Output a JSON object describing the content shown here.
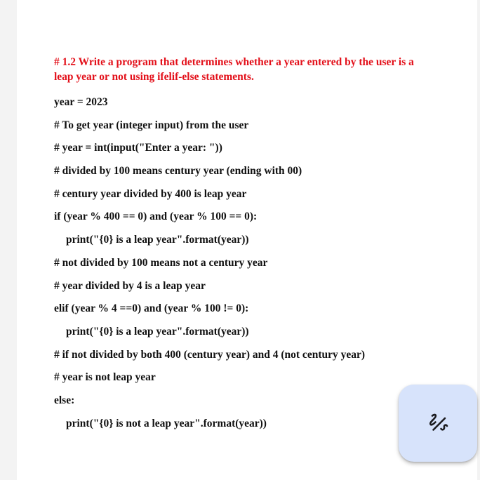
{
  "document": {
    "heading": "# 1.2 Write a program that determines whether a year entered by the user is a leap year or not using ifelif-else statements.",
    "lines": [
      {
        "text": "year = 2023",
        "indent": false
      },
      {
        "text": "# To get year (integer input) from the user",
        "indent": false
      },
      {
        "text": "# year = int(input(\"Enter a year: \"))",
        "indent": false
      },
      {
        "text": "# divided by 100 means century year (ending with 00)",
        "indent": false
      },
      {
        "text": "# century year divided by 400 is leap year",
        "indent": false
      },
      {
        "text": "if (year % 400 == 0) and (year % 100 == 0):",
        "indent": false
      },
      {
        "text": "print(\"{0} is a leap year\".format(year))",
        "indent": true
      },
      {
        "text": "# not divided by 100 means not a century year",
        "indent": false
      },
      {
        "text": "# year divided by 4 is a leap year",
        "indent": false
      },
      {
        "text": "elif (year % 4 ==0) and (year % 100 != 0):",
        "indent": false
      },
      {
        "text": "print(\"{0} is a leap year\".format(year))",
        "indent": true
      },
      {
        "text": "# if not divided by both 400 (century year) and 4 (not century year)",
        "indent": false
      },
      {
        "text": "# year is not leap year",
        "indent": false
      },
      {
        "text": "else:",
        "indent": false
      },
      {
        "text": "print(\"{0} is not a leap year\".format(year))",
        "indent": true
      }
    ]
  },
  "fab": {
    "icon": "draw-icon",
    "background": "#d7e3fb"
  },
  "colors": {
    "heading": "#e3101a",
    "text": "#111111"
  }
}
